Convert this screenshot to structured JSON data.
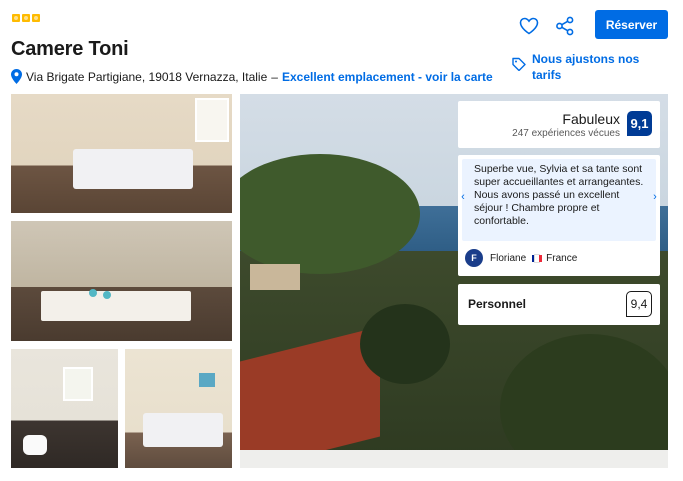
{
  "hotel": {
    "stars": 3,
    "name": "Camere Toni",
    "address": "Via Brigate Partigiane, 19018 Vernazza, Italie",
    "separator": "–",
    "location_link": "Excellent emplacement - voir la carte"
  },
  "actions": {
    "favorite_icon": "heart-icon",
    "share_icon": "share-icon",
    "reserve_label": "Réserver",
    "price_match": "Nous ajustons nos tarifs"
  },
  "rating": {
    "label": "Fabuleux",
    "subtitle": "247 expériences vécues",
    "score": "9,1"
  },
  "review": {
    "text": "Superbe vue, Sylvia et sa tante sont super accueillantes et arrangeantes. Nous avons passé un excellent séjour ! Chambre propre et confortable.",
    "reviewer_initial": "F",
    "reviewer_name": "Floriane",
    "country": "France",
    "prev": "‹",
    "next": "›"
  },
  "category": {
    "label": "Personnel",
    "score": "9,4"
  },
  "colors": {
    "brand_blue": "#006ce4",
    "score_blue": "#003b95",
    "star_yellow": "#febb02"
  }
}
